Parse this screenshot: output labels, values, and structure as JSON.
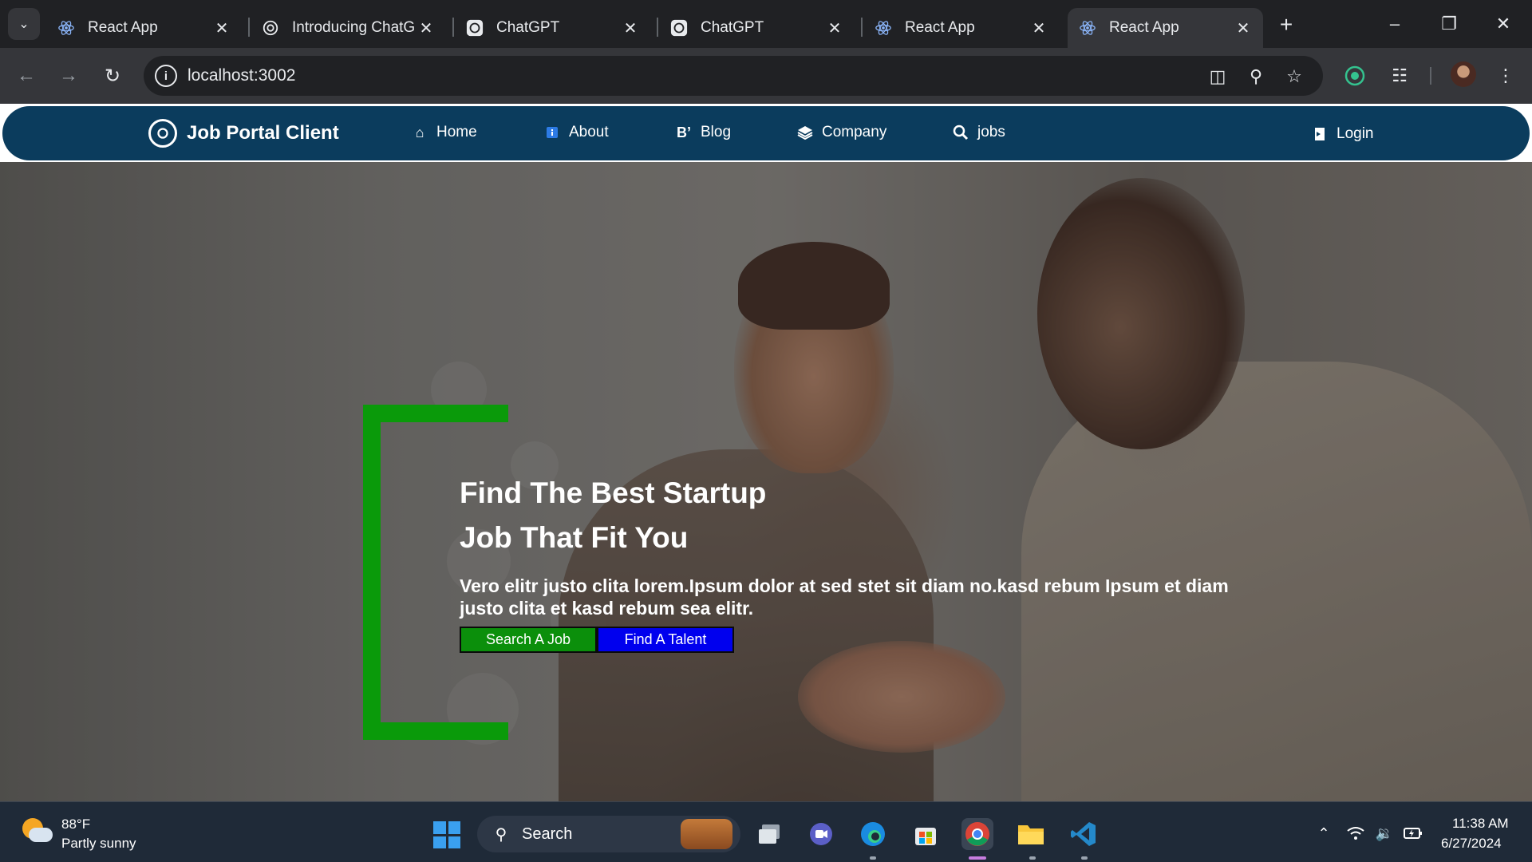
{
  "browser": {
    "tabs": [
      {
        "title": "React App",
        "icon": "react-icon"
      },
      {
        "title": "Introducing ChatG",
        "icon": "openai-icon"
      },
      {
        "title": "ChatGPT",
        "icon": "openai-icon"
      },
      {
        "title": "ChatGPT",
        "icon": "openai-icon"
      },
      {
        "title": "React App",
        "icon": "react-icon"
      },
      {
        "title": "React App",
        "icon": "react-icon",
        "active": true
      }
    ],
    "url": "localhost:3002"
  },
  "site": {
    "brand": "Job Portal Client",
    "nav": [
      {
        "label": "Home",
        "icon": "home-icon"
      },
      {
        "label": "About",
        "icon": "info-icon"
      },
      {
        "label": "Blog",
        "icon": "blogger-icon"
      },
      {
        "label": "Company",
        "icon": "layers-icon"
      },
      {
        "label": "jobs",
        "icon": "search-icon"
      }
    ],
    "login": "Login",
    "navbar_color": "#0b3c5d"
  },
  "hero": {
    "title_line1": "Find The Best Startup",
    "title_line2": "Job That Fit You",
    "text": "Vero elitr justo clita lorem.Ipsum dolor at sed stet sit diam no.kasd rebum Ipsum et diam justo clita et kasd rebum sea elitr.",
    "btn_search": "Search A Job",
    "btn_talent": "Find A Talent",
    "accent_green": "#0a9a0a",
    "accent_blue": "#0000ee"
  },
  "taskbar": {
    "weather_temp": "88°F",
    "weather_desc": "Partly sunny",
    "search_label": "Search",
    "time": "11:38 AM",
    "date": "6/27/2024"
  }
}
